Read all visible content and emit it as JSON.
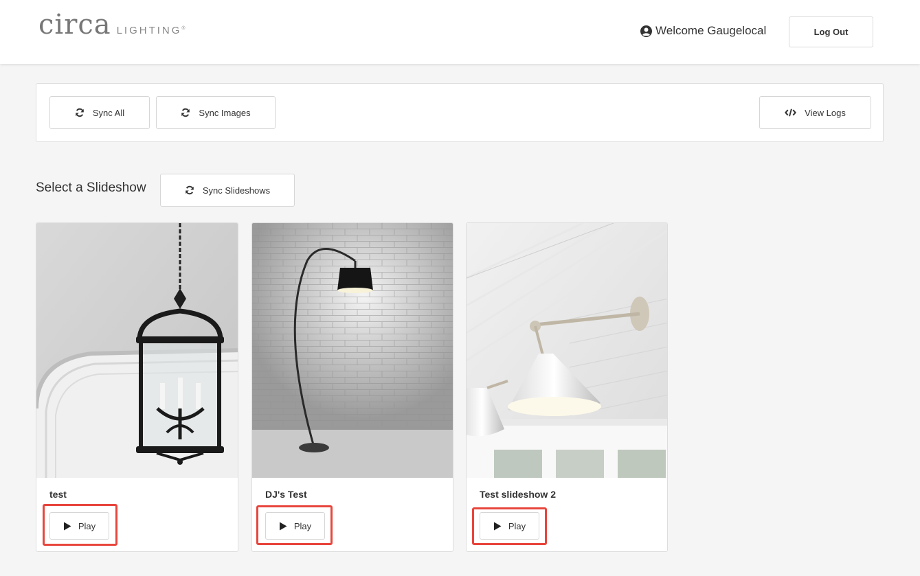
{
  "header": {
    "logo_main": "circa",
    "logo_sub": "LIGHTING",
    "logo_reg": "®",
    "welcome_text": "Welcome Gaugelocal",
    "logout_label": "Log Out"
  },
  "toolbar": {
    "sync_all_label": "Sync All",
    "sync_images_label": "Sync Images",
    "view_logs_label": "View Logs"
  },
  "slideshows": {
    "section_title": "Select a Slideshow",
    "sync_label": "Sync Slideshows",
    "items": [
      {
        "title": "test",
        "play_label": "Play",
        "image": "lantern-chandelier-photo"
      },
      {
        "title": "DJ's Test",
        "play_label": "Play",
        "image": "arc-floor-lamp-photo"
      },
      {
        "title": "Test slideshow 2",
        "play_label": "Play",
        "image": "wall-sconce-photo"
      }
    ]
  },
  "colors": {
    "highlight": "#e8453c",
    "background": "#f5f5f5"
  }
}
